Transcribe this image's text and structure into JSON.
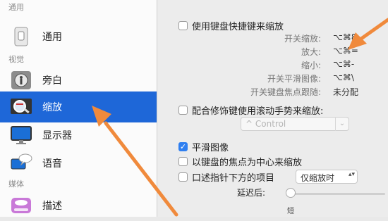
{
  "sidebar": {
    "sections": [
      {
        "header": "通用"
      },
      {
        "header": "视觉"
      },
      {
        "header": "媒体"
      }
    ],
    "items": [
      {
        "label": "通用",
        "icon": "general-icon"
      },
      {
        "label": "旁白",
        "icon": "voiceover-icon"
      },
      {
        "label": "缩放",
        "icon": "zoom-icon",
        "selected": true
      },
      {
        "label": "显示器",
        "icon": "display-icon"
      },
      {
        "label": "语音",
        "icon": "speech-icon"
      },
      {
        "label": "描述",
        "icon": "descriptions-icon"
      }
    ]
  },
  "zoom": {
    "keyboard_shortcuts": {
      "label": "使用键盘快捷键来缩放",
      "checked": false,
      "rows": [
        {
          "name": "开关缩放:",
          "keys": "⌥⌘8"
        },
        {
          "name": "放大:",
          "keys": "⌥⌘="
        },
        {
          "name": "缩小:",
          "keys": "⌥⌘-"
        },
        {
          "name": "开关平滑图像:",
          "keys": "⌥⌘\\"
        },
        {
          "name": "开关键盘焦点跟随:",
          "keys": "未分配"
        }
      ]
    },
    "scroll_gesture": {
      "label": "配合修饰键使用滚动手势来缩放:",
      "checked": false,
      "select_value": "^ Control"
    },
    "smooth_images": {
      "label": "平滑图像",
      "checked": true
    },
    "follow_focus": {
      "label": "以键盘的焦点为中心来缩放",
      "checked": false
    },
    "speak_under_pointer": {
      "label": "口述指针下方的项目",
      "checked": false,
      "select_value": "仅缩放时"
    },
    "delay": {
      "label": "延迟后:",
      "short_label": "短",
      "level": 0
    }
  },
  "colors": {
    "selected": "#1e67d8",
    "annotation_arrow": "#f08a3c",
    "checkbox_on": "#2f7ff0"
  }
}
